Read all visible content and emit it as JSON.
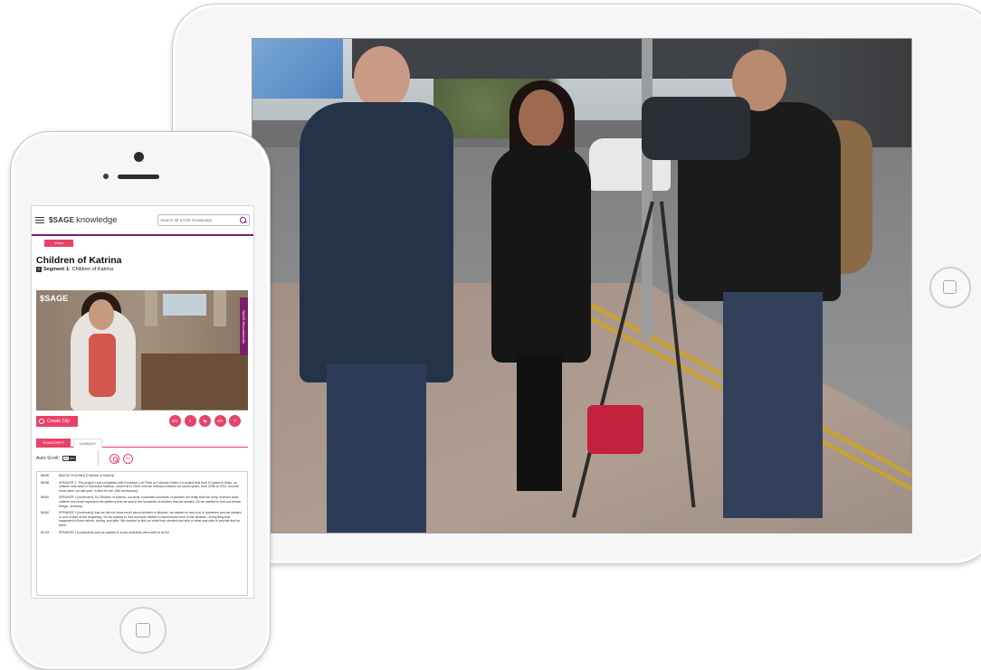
{
  "header": {
    "logo_mark": "$SAGE",
    "logo_word": "knowledge",
    "search_placeholder": "Search all SAGE Knowledge"
  },
  "content_type": "Video",
  "title": "Children of Katrina",
  "segment": {
    "label": "Segment 1:",
    "name": "Children of Katrina"
  },
  "player": {
    "watermark": "$SAGE",
    "side_tab": "SAGE Recommends"
  },
  "actions": {
    "create_clip": "Create Clip",
    "tools": [
      "CC",
      "≡",
      "⇆",
      "</>",
      "?"
    ]
  },
  "tabs": [
    "TRANSCRIPT",
    "SUMMARY"
  ],
  "autoscroll": {
    "label": "Auto-Scroll:",
    "on": "ON",
    "off": "OFF"
  },
  "transcript_pdf": "PDF",
  "transcript": [
    {
      "time": "00:00",
      "text": "[MUSIC PLAYING] [Children of Katrina]"
    },
    {
      "time": "00:09",
      "text": "SPEAKER 1: The project I just completed with Professor Lori Peek at Colorado State is a project that took 10 years to finish, on children who were in Hurricane Katrina—which hit in 2005. And we followed children for seven years, from 2005 to 2012. And the book came out last year, in time for the 10th anniversary."
    },
    {
      "time": "00:31",
      "text": "SPEAKER 1 [continued]: So Children of Katrina, our book, examines hundreds of children but really tells the story of seven focal children who least represent the patterns that we saw in the hundreds of children that we studied. So we wanted to find out certain things—knowing"
    },
    {
      "time": "00:52",
      "text": "SPEAKER 1 [continued]: that we did not know much about children in disaster, we wanted to ask a lot of questions and we wanted to sort of start at the beginning. So we wanted to find out what children's experiences were in the disaster—everything that happened to them before, during, and after. We wanted to find out what they needed and who or what was able to provide that for them."
    },
    {
      "time": "01:13",
      "text": "SPEAKER 1 [continued]: and we wanted to know what they were able to do for"
    }
  ]
}
